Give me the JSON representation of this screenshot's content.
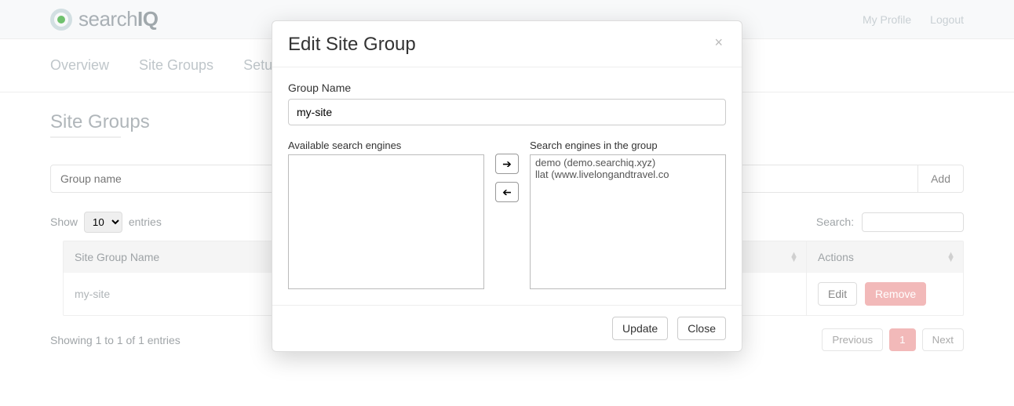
{
  "brand": {
    "name_left": "search",
    "name_right": "IQ"
  },
  "top_links": {
    "profile": "My Profile",
    "logout": "Logout"
  },
  "nav": {
    "overview": "Overview",
    "site_groups": "Site Groups",
    "setup": "Setup"
  },
  "page": {
    "title": "Site Groups",
    "group_name_placeholder": "Group name",
    "add_button": "Add",
    "show_prefix": "Show",
    "show_suffix": "entries",
    "show_value": "10",
    "search_label": "Search:",
    "columns": {
      "name": "Site Group Name",
      "actions": "Actions"
    },
    "rows": [
      {
        "name": "my-site",
        "edit": "Edit",
        "remove": "Remove"
      }
    ],
    "footer_info": "Showing 1 to 1 of 1 entries",
    "pager": {
      "prev": "Previous",
      "page": "1",
      "next": "Next"
    }
  },
  "modal": {
    "title": "Edit Site Group",
    "group_name_label": "Group Name",
    "group_name_value": "my-site",
    "available_label": "Available search engines",
    "in_group_label": "Search engines in the group",
    "available_items": [],
    "in_group_items": [
      "demo (demo.searchiq.xyz)",
      "llat (www.livelongandtravel.co"
    ],
    "update": "Update",
    "close": "Close"
  }
}
